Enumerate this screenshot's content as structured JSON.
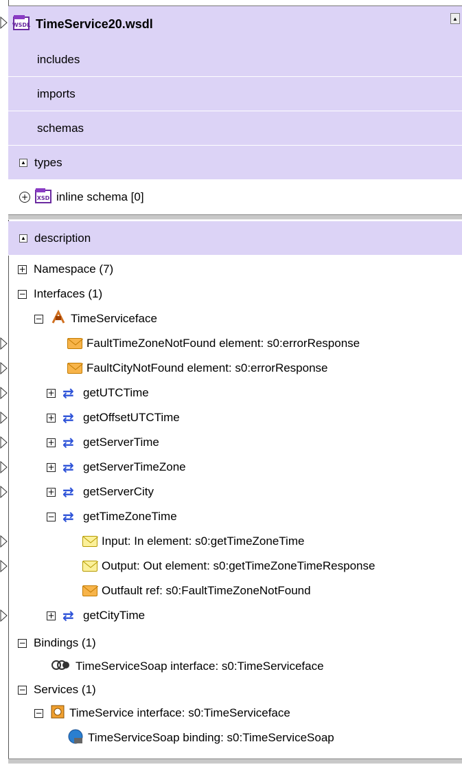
{
  "header": {
    "title": "TimeService20.wsdl"
  },
  "types_section": {
    "rows": [
      {
        "label": "includes"
      },
      {
        "label": "imports"
      },
      {
        "label": "schemas"
      }
    ],
    "types_label": "types",
    "inline_schema_label": "inline schema [0]"
  },
  "description": {
    "label": "description",
    "namespace": "Namespace (7)",
    "interfaces": "Interfaces (1)",
    "interface_name": "TimeServiceface",
    "faults": [
      "FaultTimeZoneNotFound  element: s0:errorResponse",
      "FaultCityNotFound  element: s0:errorResponse"
    ],
    "operations": [
      "getUTCTime",
      "getOffsetUTCTime",
      "getServerTime",
      "getServerTimeZone",
      "getServerCity",
      "getTimeZoneTime",
      "getCityTime"
    ],
    "messages": [
      "Input: In  element: s0:getTimeZoneTime",
      "Output: Out  element: s0:getTimeZoneTimeResponse",
      "Outfault  ref: s0:FaultTimeZoneNotFound"
    ],
    "bindings": "Bindings (1)",
    "binding_item": "TimeServiceSoap  interface: s0:TimeServiceface",
    "services": "Services (1)",
    "service_item": "TimeService  interface: s0:TimeServiceface",
    "endpoint_item": "TimeServiceSoap  binding: s0:TimeServiceSoap"
  },
  "icons": {
    "wsdl": "wsdl-file-icon",
    "xsd": "xsd-schema-icon",
    "interface": "interface-icon",
    "fault": "fault-envelope-icon",
    "operation": "operation-arrows-icon",
    "message": "message-envelope-icon",
    "binding": "binding-icon",
    "service": "service-icon",
    "endpoint": "endpoint-globe-icon"
  },
  "colors": {
    "section_bg": "#dcd3f6",
    "arrow_blue": "#2f54d8",
    "fault_orange": "#f7b44a",
    "message_yellow": "#fbf09a"
  }
}
